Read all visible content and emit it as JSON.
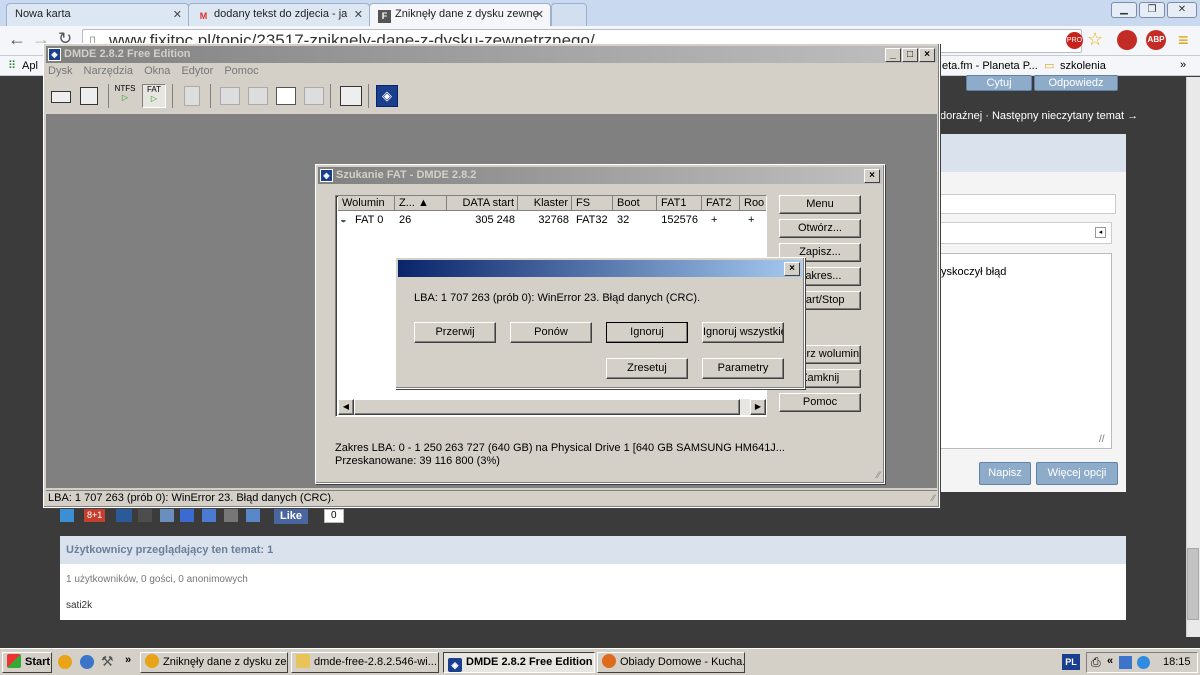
{
  "browser": {
    "tabs": [
      {
        "label": "Nowa karta"
      },
      {
        "label": "dodany tekst do zdjecia - ja"
      },
      {
        "label": "Zniknęły dane z dysku zewnę"
      }
    ],
    "url": "www.fixitpc.pl/topic/23517-znikne ly-dane-z-dysku-zewnetrznego/",
    "url_visible": "www.fixitpc.pl/topic/23517-zniknely-dane-z-dysku-zewnetrznego/",
    "bookmarks": [
      {
        "label": "Apl"
      },
      {
        "label": "eta.fm - Planeta P..."
      },
      {
        "label": "szkolenia"
      }
    ],
    "bookmarks_more": "»"
  },
  "forum": {
    "quote_button": "Cytuj",
    "reply_button": "Odpowiedz",
    "nav_text": "doraźnej · Następny nieczytany temat →",
    "editor_text": "yskoczył błąd",
    "write_button": "Napisz",
    "more_options_button": "Więcej opcji",
    "like_label": "Like",
    "like_count": "0",
    "share_g1": "8+1",
    "viewers_title": "Użytkownicy przeglądający ten temat: 1",
    "viewers_stats": "1 użytkowników, 0 gości, 0 anonimowych",
    "viewer_name": "sati2k"
  },
  "dmde": {
    "title": "DMDE 2.8.2 Free Edition",
    "menu": [
      "Dysk",
      "Narzędzia",
      "Okna",
      "Edytor",
      "Pomoc"
    ],
    "toolbar": {
      "ntfs": "NTFS",
      "fat": "FAT"
    },
    "status": "LBA: 1 707 263 (prób 0): WinError 23. Błąd danych (CRC)."
  },
  "fat_search": {
    "title": "Szukanie FAT - DMDE 2.8.2",
    "columns": [
      "Wolumin",
      "Z... ▲",
      "DATA start",
      "Klaster",
      "FS",
      "Boot",
      "FAT1",
      "FAT2",
      "Roo"
    ],
    "row": [
      "FAT 0",
      "26",
      "305 248",
      "32768",
      "FAT32",
      "32",
      "152576",
      "+",
      "+"
    ],
    "buttons": [
      "Menu",
      "Otwórz...",
      "Zapisz...",
      "Zakres...",
      "Start/Stop",
      "Otwórz wolumin",
      "Zamknij",
      "Pomoc"
    ],
    "lba_range": "Zakres LBA: 0 - 1 250 263 727 (640 GB) na Physical Drive 1 [640 GB SAMSUNG HM641J...",
    "scanned": "Przeskanowane: 39 116 800 (3%)"
  },
  "error_dialog": {
    "message": "LBA: 1 707 263 (prób 0): WinError 23. Błąd danych (CRC).",
    "buttons": {
      "abort": "Przerwij",
      "retry": "Ponów",
      "ignore": "Ignoruj",
      "ignore_all": "Ignoruj wszystkie",
      "reset": "Zresetuj",
      "params": "Parametry"
    }
  },
  "taskbar": {
    "start": "Start",
    "chevron": "»",
    "tasks": [
      "Zniknęły dane z dysku ze...",
      "dmde-free-2.8.2.546-wi...",
      "DMDE 2.8.2 Free Edition",
      "Obiady Domowe - Kucha..."
    ],
    "lang": "PL",
    "tray_chevron": "«",
    "clock": "18:15"
  }
}
